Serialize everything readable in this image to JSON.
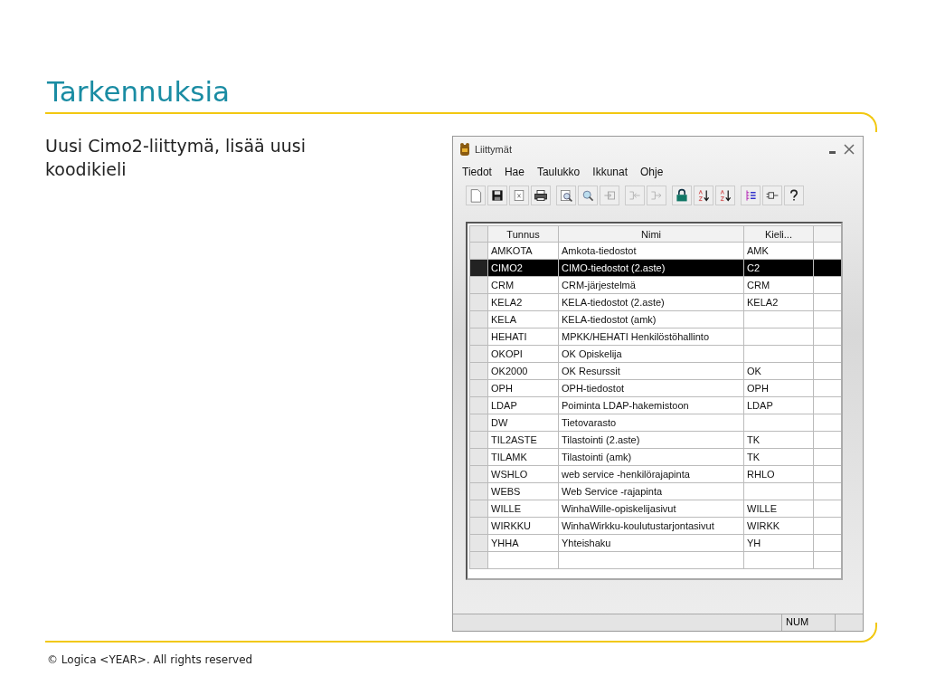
{
  "slide": {
    "title": "Tarkennuksia",
    "text": "Uusi Cimo2-liittymä, lisää uusi koodikieli",
    "footer": "© Logica <YEAR>. All rights reserved"
  },
  "window": {
    "title": "Liittymät",
    "menu": [
      "Tiedot",
      "Hae",
      "Taulukko",
      "Ikkunat",
      "Ohje"
    ]
  },
  "table": {
    "columns": [
      "Tunnus",
      "Nimi",
      "Kieli..."
    ],
    "rows": [
      {
        "cells": [
          "AMKOTA",
          "Amkota-tiedostot",
          "AMK"
        ],
        "selected": false
      },
      {
        "cells": [
          "CIMO2",
          "CIMO-tiedostot (2.aste)",
          "C2"
        ],
        "selected": true
      },
      {
        "cells": [
          "CRM",
          "CRM-järjestelmä",
          "CRM"
        ],
        "selected": false
      },
      {
        "cells": [
          "KELA2",
          "KELA-tiedostot (2.aste)",
          "KELA2"
        ],
        "selected": false
      },
      {
        "cells": [
          "KELA",
          "KELA-tiedostot (amk)",
          ""
        ],
        "selected": false
      },
      {
        "cells": [
          "HEHATI",
          "MPKK/HEHATI Henkilöstöhallinto",
          ""
        ],
        "selected": false
      },
      {
        "cells": [
          "OKOPI",
          "OK Opiskelija",
          ""
        ],
        "selected": false
      },
      {
        "cells": [
          "OK2000",
          "OK Resurssit",
          "OK"
        ],
        "selected": false
      },
      {
        "cells": [
          "OPH",
          "OPH-tiedostot",
          "OPH"
        ],
        "selected": false
      },
      {
        "cells": [
          "LDAP",
          "Poiminta LDAP-hakemistoon",
          "LDAP"
        ],
        "selected": false
      },
      {
        "cells": [
          "DW",
          "Tietovarasto",
          ""
        ],
        "selected": false
      },
      {
        "cells": [
          "TIL2ASTE",
          "Tilastointi (2.aste)",
          "TK"
        ],
        "selected": false
      },
      {
        "cells": [
          "TILAMK",
          "Tilastointi (amk)",
          "TK"
        ],
        "selected": false
      },
      {
        "cells": [
          "WSHLO",
          "web service -henkilörajapinta",
          "RHLO"
        ],
        "selected": false
      },
      {
        "cells": [
          "WEBS",
          "Web Service -rajapinta",
          ""
        ],
        "selected": false
      },
      {
        "cells": [
          "WILLE",
          "WinhaWille-opiskelijasivut",
          "WILLE"
        ],
        "selected": false
      },
      {
        "cells": [
          "WIRKKU",
          "WinhaWirkku-koulutustarjontasivut",
          "WIRKK"
        ],
        "selected": false
      },
      {
        "cells": [
          "YHHA",
          "Yhteishaku",
          "YH"
        ],
        "selected": false
      }
    ]
  },
  "status_bar": {
    "panel": "NUM"
  }
}
